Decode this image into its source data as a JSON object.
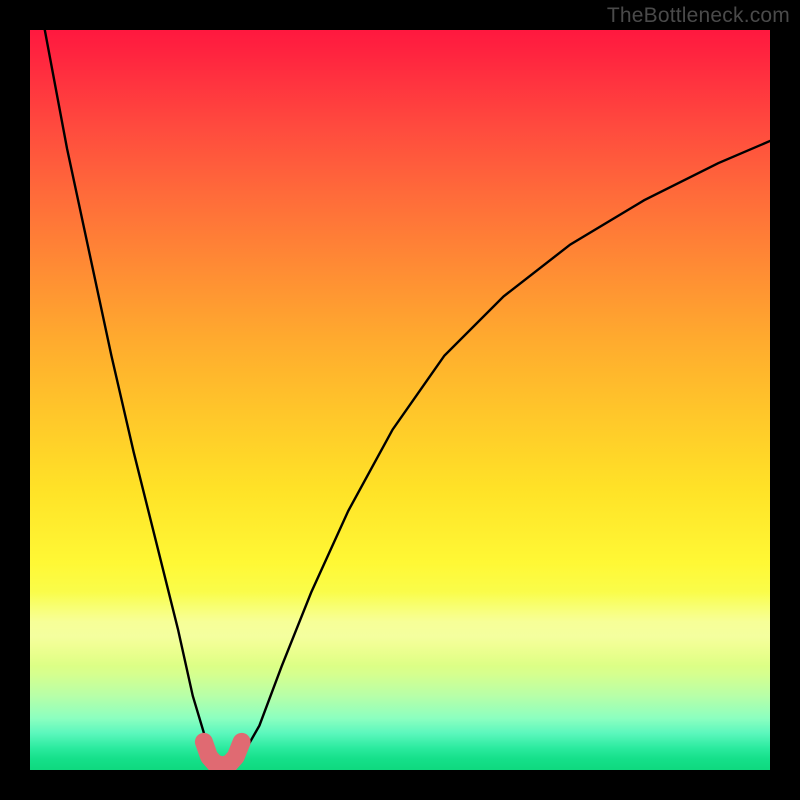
{
  "watermark": "TheBottleneck.com",
  "chart_data": {
    "type": "line",
    "title": "",
    "xlabel": "",
    "ylabel": "",
    "xlim": [
      0,
      100
    ],
    "ylim": [
      0,
      100
    ],
    "grid": false,
    "legend": false,
    "background": "rainbow-vertical",
    "series": [
      {
        "name": "left-branch",
        "x": [
          2,
          5,
          8,
          11,
          14,
          17,
          20,
          22,
          23.5,
          24.5,
          25.5
        ],
        "values": [
          100,
          84,
          70,
          56,
          43,
          31,
          19,
          10,
          5,
          2.2,
          1.0
        ]
      },
      {
        "name": "right-branch",
        "x": [
          27.5,
          29,
          31,
          34,
          38,
          43,
          49,
          56,
          64,
          73,
          83,
          93,
          100
        ],
        "values": [
          1.0,
          2.5,
          6,
          14,
          24,
          35,
          46,
          56,
          64,
          71,
          77,
          82,
          85
        ]
      },
      {
        "name": "bottom-marker",
        "style": "thick-pink",
        "x": [
          23.5,
          24.2,
          25.0,
          26.0,
          27.0,
          27.8,
          28.6
        ],
        "values": [
          3.8,
          1.8,
          0.9,
          0.6,
          0.9,
          1.8,
          3.8
        ]
      }
    ],
    "colors": {
      "curve": "#000000",
      "marker": "#e06a72",
      "gradient_top": "#ff183f",
      "gradient_mid": "#ffe227",
      "gradient_bottom": "#0fd97f"
    }
  }
}
